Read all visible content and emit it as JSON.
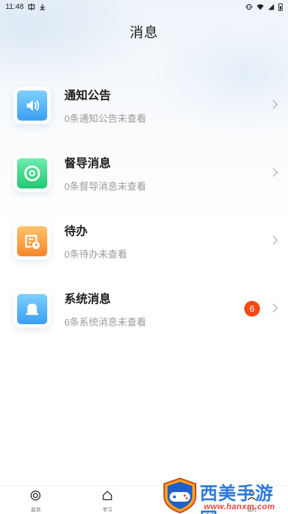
{
  "status_bar": {
    "time": "11:48"
  },
  "header": {
    "title": "消息"
  },
  "messages": [
    {
      "title": "通知公告",
      "subtitle": "0条通知公告未查看",
      "icon": "speaker-icon",
      "color": "#3aa5f5",
      "badge": ""
    },
    {
      "title": "督导消息",
      "subtitle": "0条督导消息未查看",
      "icon": "eye-icon",
      "color": "#2fd27e",
      "badge": ""
    },
    {
      "title": "待办",
      "subtitle": "0条待办未查看",
      "icon": "todo-clock-icon",
      "color": "#f7912c",
      "badge": ""
    },
    {
      "title": "系统消息",
      "subtitle": "6条系统消息未查看",
      "icon": "bell-icon",
      "color": "#3aa5f5",
      "badge": "6"
    }
  ],
  "bottom_nav": {
    "items": [
      {
        "label": "监测",
        "icon": "target-icon"
      },
      {
        "label": "学习",
        "icon": "home-icon"
      },
      {
        "label": "我的",
        "icon": "user-icon"
      }
    ]
  },
  "watermark": {
    "name": "西美手游网",
    "url": "www.hanxm.com"
  }
}
